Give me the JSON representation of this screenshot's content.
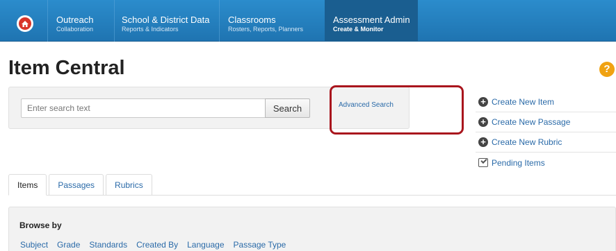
{
  "nav": {
    "items": [
      {
        "title": "Outreach",
        "subtitle": "Collaboration"
      },
      {
        "title": "School & District Data",
        "subtitle": "Reports & Indicators"
      },
      {
        "title": "Classrooms",
        "subtitle": "Rosters, Reports, Planners"
      },
      {
        "title": "Assessment Admin",
        "subtitle": "Create & Monitor"
      }
    ]
  },
  "page": {
    "title": "Item Central",
    "help": "?"
  },
  "search": {
    "placeholder": "Enter search text",
    "value": "",
    "button": "Search",
    "advanced": "Advanced Search"
  },
  "actions": {
    "create_item": "Create New Item",
    "create_passage": "Create New Passage",
    "create_rubric": "Create New Rubric",
    "pending": "Pending Items"
  },
  "tabs": [
    "Items",
    "Passages",
    "Rubrics"
  ],
  "browse": {
    "title": "Browse by",
    "links": [
      "Subject",
      "Grade",
      "Standards",
      "Created By",
      "Language",
      "Passage Type"
    ]
  },
  "colors": {
    "nav_bg": "#2386c8",
    "nav_active": "#1a5e90",
    "link": "#2a6aa8",
    "highlight": "#a9151d",
    "help": "#f0a212"
  }
}
